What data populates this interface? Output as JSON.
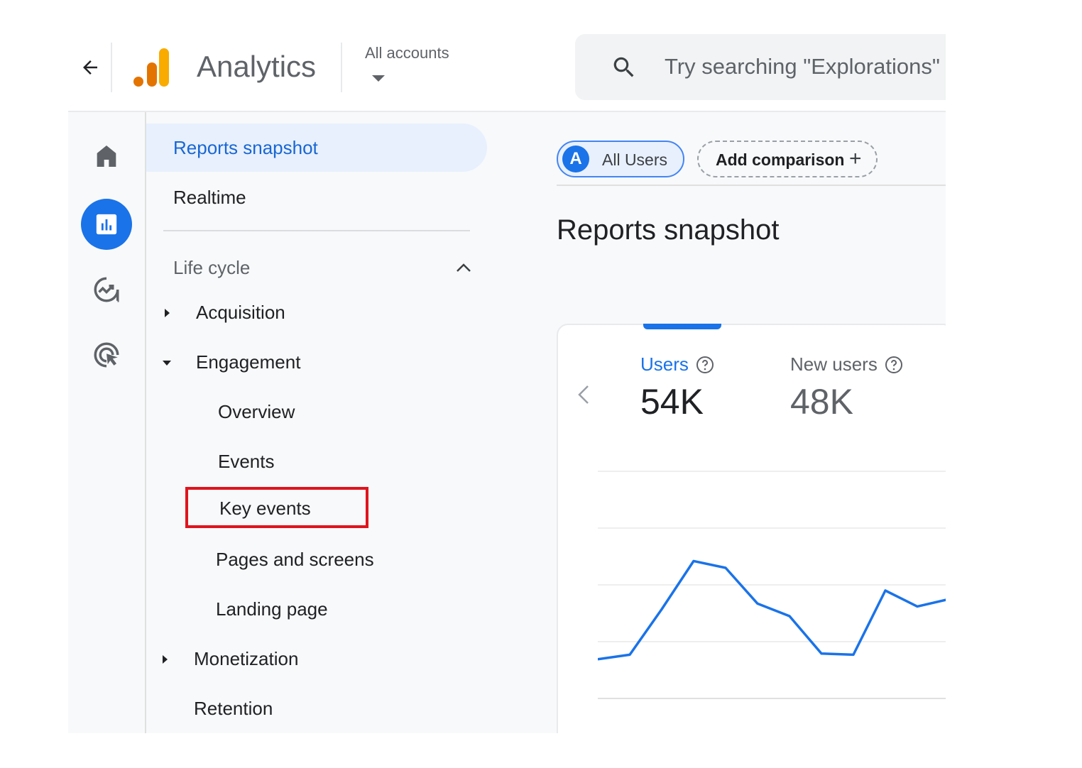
{
  "header": {
    "back_icon": "arrow-left-icon",
    "logo_icon": "analytics-bars-logo",
    "app_title": "Analytics",
    "account_selector": "All accounts",
    "search_placeholder": "Try searching \"Explorations\""
  },
  "rail": {
    "items": [
      {
        "name": "home",
        "icon": "home-icon",
        "active": false
      },
      {
        "name": "reports",
        "icon": "bar-chart-icon",
        "active": true
      },
      {
        "name": "explore",
        "icon": "explore-trend-icon",
        "active": false
      },
      {
        "name": "advertising",
        "icon": "target-cursor-icon",
        "active": false
      }
    ]
  },
  "nav": {
    "items": [
      {
        "label": "Reports snapshot",
        "active": true
      },
      {
        "label": "Realtime"
      }
    ],
    "section": {
      "label": "Life cycle",
      "expanded": true
    },
    "lifecycle": [
      {
        "label": "Acquisition",
        "expandable": true,
        "expanded": false
      },
      {
        "label": "Engagement",
        "expandable": true,
        "expanded": true,
        "children": [
          "Overview",
          "Events",
          "Key events",
          "Pages and screens",
          "Landing page"
        ]
      },
      {
        "label": "Monetization",
        "expandable": true,
        "expanded": false
      },
      {
        "label": "Retention",
        "expandable": false
      }
    ],
    "highlighted_item": "Key events"
  },
  "main": {
    "comparison_chip": {
      "avatar": "A",
      "label": "All Users"
    },
    "add_comparison": {
      "label": "Add comparison",
      "icon": "+"
    },
    "page_title": "Reports snapshot",
    "metrics": [
      {
        "name": "Users",
        "value": "54K",
        "selected": true
      },
      {
        "name": "New users",
        "value": "48K",
        "selected": false
      }
    ]
  },
  "colors": {
    "accent": "#1a73e8",
    "highlight_box": "#e0141e",
    "active_nav_bg": "#e8f0fe"
  },
  "chart_data": {
    "type": "line",
    "title": "",
    "xlabel": "",
    "ylabel": "",
    "note": "No axis labels visible; values in gridline units (0 = bottom gridline, each gridline = 1)",
    "ylim": [
      0,
      4
    ],
    "gridlines": 5,
    "series": [
      {
        "name": "Users",
        "color": "#1a73e8",
        "values": [
          0.69,
          0.77,
          1.57,
          2.42,
          2.3,
          1.67,
          1.45,
          0.79,
          0.77,
          1.9,
          1.62,
          1.75
        ]
      }
    ]
  }
}
